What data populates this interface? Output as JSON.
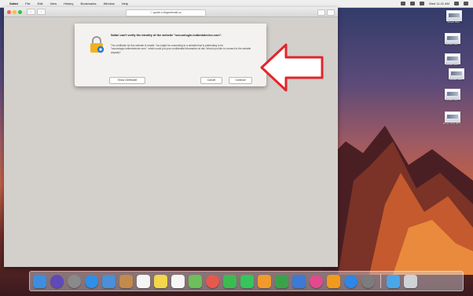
{
  "menubar": {
    "apple": "",
    "items": [
      "Safari",
      "File",
      "Edit",
      "View",
      "History",
      "Bookmarks",
      "Window",
      "Help"
    ],
    "clock": "Wed 11:41 AM"
  },
  "browser": {
    "url": " quote.c.hbgcertmail.co",
    "nav_back": "‹",
    "nav_fwd": "›"
  },
  "dialog": {
    "title": "Safari can't verify the identity of the website \"securelogin.icdbmbdevice.com\".",
    "body": "The certificate for this website is invalid. You might be connecting to a website that is pretending to be \"securelogin.icdbmbdevice.com\", which could put your confidential information at risk. Would you like to connect to the website anyway?",
    "show_certificate": "Show Certificate",
    "cancel": "Cancel",
    "continue": "Continue"
  },
  "desktop_icons": [
    {
      "label": "Screen Shot"
    },
    {
      "label": "Screen Shot"
    },
    {
      "label": "Screen Shot"
    },
    {
      "label": "Screen Shot"
    },
    {
      "label": "Screen Shot"
    },
    {
      "label": "Screen Shot 2017"
    }
  ],
  "dock": {
    "apps": [
      {
        "name": "finder",
        "color": "#3d8ee0"
      },
      {
        "name": "siri",
        "color": "#5f4ab8"
      },
      {
        "name": "launchpad",
        "color": "#8a8a8a"
      },
      {
        "name": "safari",
        "color": "#2f8fe6"
      },
      {
        "name": "mail",
        "color": "#4a8fd8"
      },
      {
        "name": "contacts",
        "color": "#c28a4c"
      },
      {
        "name": "calendar",
        "color": "#f4f4f4"
      },
      {
        "name": "notes",
        "color": "#f2d64b"
      },
      {
        "name": "reminders",
        "color": "#f6f6f6"
      },
      {
        "name": "maps",
        "color": "#6cbf5a"
      },
      {
        "name": "photos",
        "color": "#e8584c"
      },
      {
        "name": "messages",
        "color": "#3dbb51"
      },
      {
        "name": "facetime",
        "color": "#34c55c"
      },
      {
        "name": "pages",
        "color": "#f19a2c"
      },
      {
        "name": "numbers",
        "color": "#3aa34a"
      },
      {
        "name": "keynote",
        "color": "#3c7ad6"
      },
      {
        "name": "itunes",
        "color": "#e04b8d"
      },
      {
        "name": "ibooks",
        "color": "#f29a1c"
      },
      {
        "name": "app-store",
        "color": "#2e86e6"
      },
      {
        "name": "system-preferences",
        "color": "#7c7c7c"
      },
      {
        "name": "downloads-folder",
        "color": "#4aa6e8"
      },
      {
        "name": "trash",
        "color": "#cfd3d8"
      }
    ]
  },
  "colors": {
    "arrow_stroke": "#e0262b",
    "arrow_fill": "#ffffff"
  }
}
